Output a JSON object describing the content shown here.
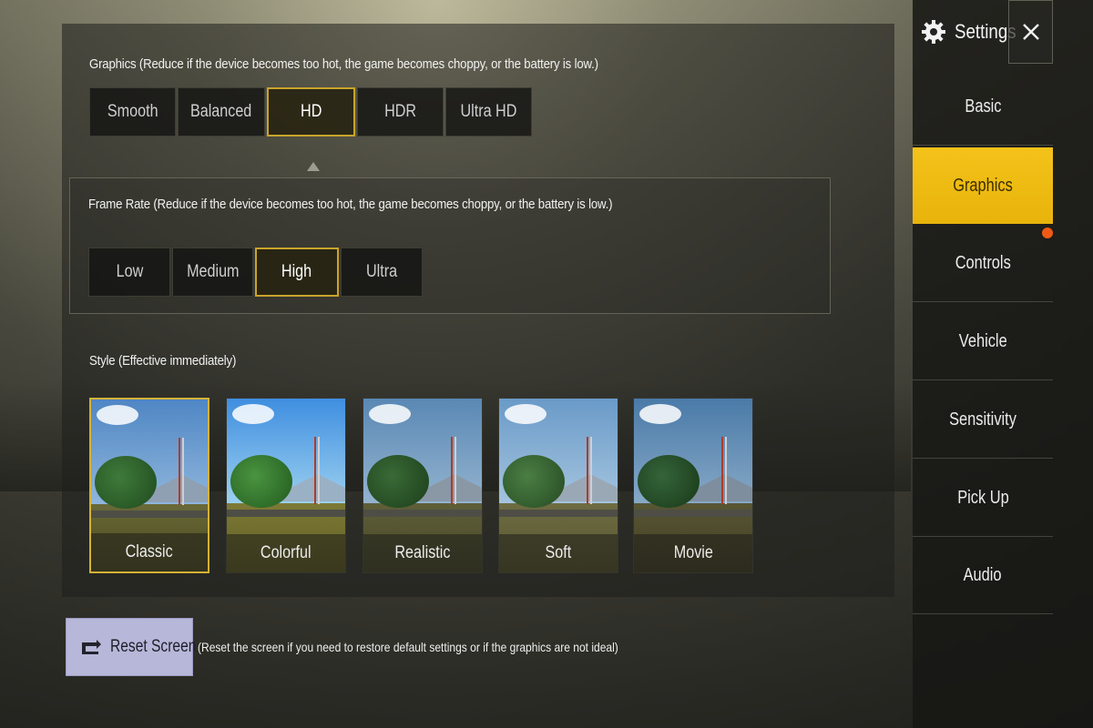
{
  "graphics": {
    "label": "Graphics (Reduce if the device becomes too hot, the game becomes choppy, or the battery is low.)",
    "options": [
      "Smooth",
      "Balanced",
      "HD",
      "HDR",
      "Ultra HD"
    ],
    "selected": "HD"
  },
  "frame_rate": {
    "label": "Frame Rate (Reduce if the device becomes too hot, the game becomes choppy, or the battery is low.)",
    "options": [
      "Low",
      "Medium",
      "High",
      "Ultra"
    ],
    "selected": "High"
  },
  "style": {
    "label": "Style (Effective immediately)",
    "options": [
      "Classic",
      "Colorful",
      "Realistic",
      "Soft",
      "Movie"
    ],
    "selected": "Classic"
  },
  "reset": {
    "label": "Reset Screen",
    "note": "(Reset the screen if you need to restore default settings or if the graphics are not ideal)"
  },
  "sidebar": {
    "title": "Settings",
    "items": [
      "Basic",
      "Graphics",
      "Controls",
      "Vehicle",
      "Sensitivity",
      "Pick Up",
      "Audio"
    ],
    "active": "Graphics"
  },
  "colors": {
    "accent": "#f4c21a",
    "selected_border": "#c9a42a",
    "notification_dot": "#f05a16"
  },
  "icons": {
    "settings": "gear-icon",
    "close": "close-icon",
    "reset": "reset-icon"
  }
}
